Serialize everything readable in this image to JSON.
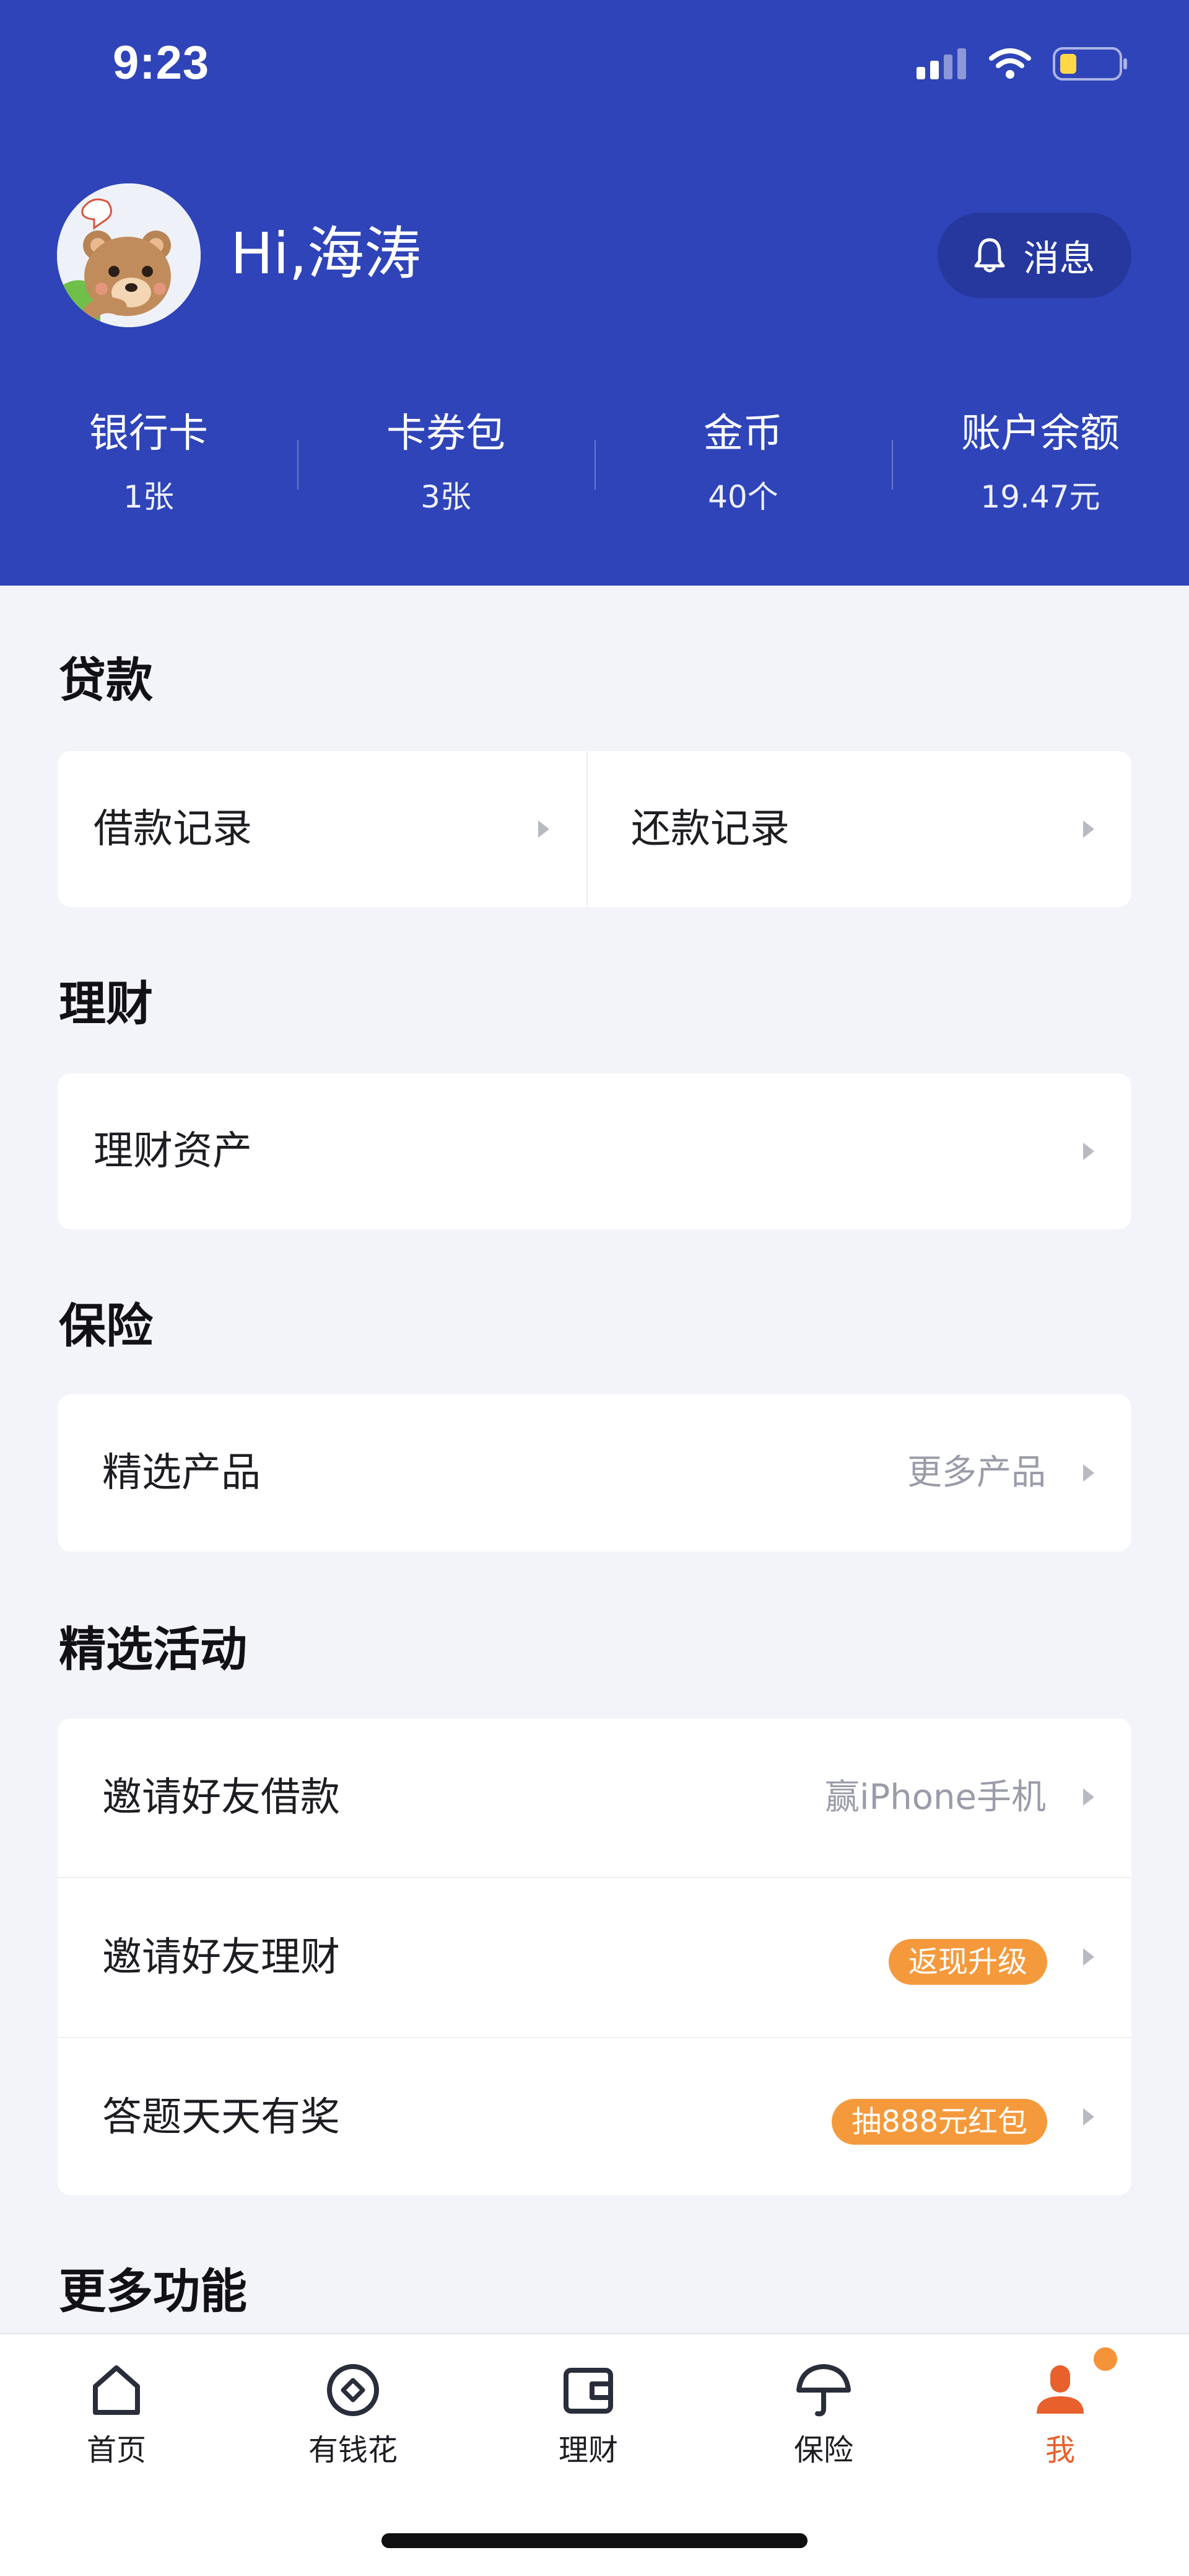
{
  "status_bar": {
    "time": "9:23"
  },
  "profile": {
    "greeting": "Hi,海涛",
    "message_label": "消息"
  },
  "stats": [
    {
      "title": "银行卡",
      "value": "1张"
    },
    {
      "title": "卡券包",
      "value": "3张"
    },
    {
      "title": "金币",
      "value": "40个"
    },
    {
      "title": "账户余额",
      "value": "19.47元"
    }
  ],
  "loan": {
    "title": "贷款",
    "items": [
      {
        "label": "借款记录"
      },
      {
        "label": "还款记录"
      }
    ]
  },
  "finance": {
    "title": "理财",
    "items": [
      {
        "label": "理财资产"
      }
    ]
  },
  "insurance": {
    "title": "保险",
    "items": [
      {
        "label": "精选产品",
        "hint": "更多产品"
      }
    ]
  },
  "activities": {
    "title": "精选活动",
    "items": [
      {
        "label": "邀请好友借款",
        "hint": "赢iPhone手机"
      },
      {
        "label": "邀请好友理财",
        "badge": "返现升级"
      },
      {
        "label": "答题天天有奖",
        "badge": "抽888元红包"
      }
    ]
  },
  "more": {
    "title": "更多功能"
  },
  "tabbar": {
    "items": [
      {
        "label": "首页",
        "icon": "home-icon"
      },
      {
        "label": "有钱花",
        "icon": "coin-icon"
      },
      {
        "label": "理财",
        "icon": "wallet-icon"
      },
      {
        "label": "保险",
        "icon": "umbrella-icon"
      },
      {
        "label": "我",
        "icon": "user-icon",
        "active": true
      }
    ]
  },
  "colors": {
    "header_bg": "#2e44b8",
    "badge_orange": "#f49a3c",
    "active_tab": "#e8602c"
  }
}
